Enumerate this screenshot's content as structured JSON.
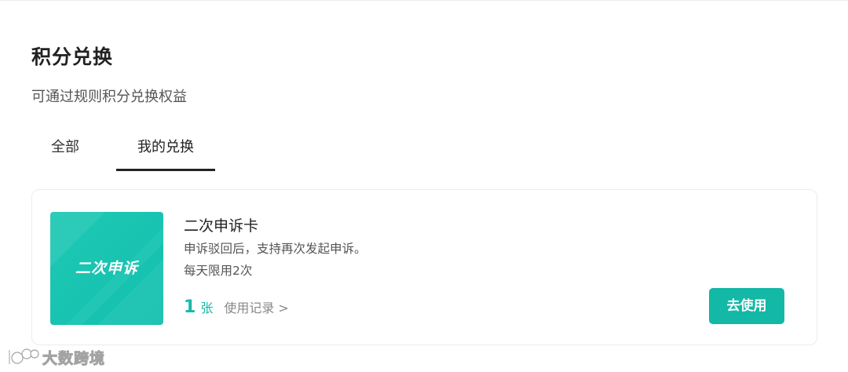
{
  "header": {
    "title": "积分兑换",
    "subtitle": "可通过规则积分兑换权益"
  },
  "tabs": [
    {
      "label": "全部",
      "active": false
    },
    {
      "label": "我的兑换",
      "active": true
    }
  ],
  "card": {
    "thumbnail_text": "二次申诉",
    "name": "二次申诉卡",
    "description": "申诉驳回后，支持再次发起申诉。",
    "limit": "每天限用2次",
    "quantity": "1",
    "quantity_unit": "张",
    "history_link": "使用记录 >",
    "use_button": "去使用"
  },
  "watermark": {
    "text": "大数跨境"
  },
  "colors": {
    "accent": "#13b8a6",
    "thumbnail_bg": "#1ec9b4",
    "text_primary": "#222222",
    "text_secondary": "#555555",
    "text_muted": "#888888"
  }
}
